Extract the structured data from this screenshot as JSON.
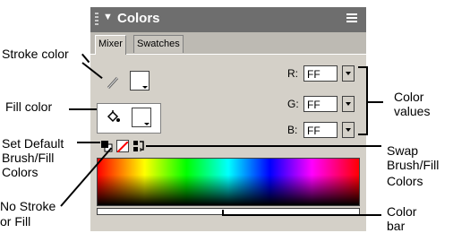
{
  "panel": {
    "title": "Colors",
    "tabs": [
      {
        "label": "Mixer",
        "active": true
      },
      {
        "label": "Swatches",
        "active": false
      }
    ],
    "rgb": [
      {
        "label": "R:",
        "value": "FF"
      },
      {
        "label": "G:",
        "value": "FF"
      },
      {
        "label": "B:",
        "value": "FF"
      }
    ]
  },
  "callouts": {
    "stroke_color": "Stroke color",
    "fill_color": "Fill color",
    "set_default": [
      "Set Default",
      "Brush/Fill",
      "Colors"
    ],
    "no_stroke": [
      "No Stroke",
      "or Fill"
    ],
    "color_values": [
      "Color",
      "values"
    ],
    "swap": [
      "Swap",
      "Brush/Fill",
      "Colors"
    ],
    "color_bar": [
      "Color",
      "bar"
    ]
  },
  "colors": {
    "titlebar": "#6e6e6e",
    "panel_bg": "#d4d0c8",
    "no_stroke_red": "#ff0000"
  }
}
